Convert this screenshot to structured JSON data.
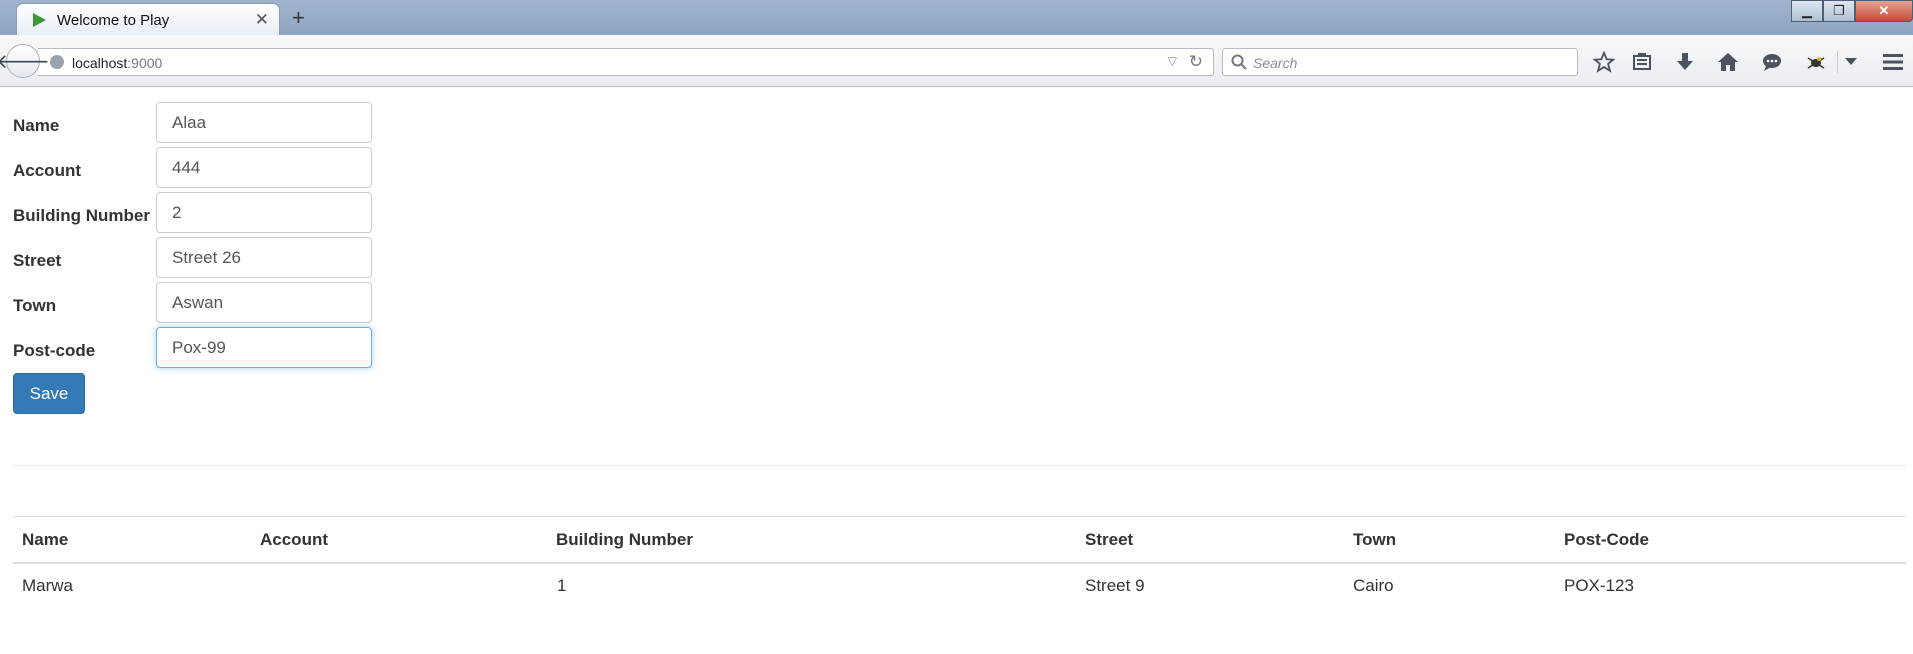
{
  "browser": {
    "tab_title": "Welcome to Play",
    "url_host": "localhost",
    "url_port": ":9000",
    "search_placeholder": "Search"
  },
  "form": {
    "fields": [
      {
        "label": "Name",
        "value": "Alaa"
      },
      {
        "label": "Account",
        "value": "444"
      },
      {
        "label": "Building Number",
        "value": "2"
      },
      {
        "label": "Street",
        "value": "Street 26"
      },
      {
        "label": "Town",
        "value": "Aswan"
      },
      {
        "label": "Post-code",
        "value": "Pox-99"
      }
    ],
    "save_label": "Save"
  },
  "table": {
    "headers": [
      "Name",
      "Account",
      "Building Number",
      "Street",
      "Town",
      "Post-Code"
    ],
    "rows": [
      [
        "Marwa",
        "",
        "1",
        "Street 9",
        "Cairo",
        "POX-123"
      ]
    ]
  },
  "colors": {
    "primary_button": "#337ab7",
    "focus_border": "#66afe9"
  }
}
